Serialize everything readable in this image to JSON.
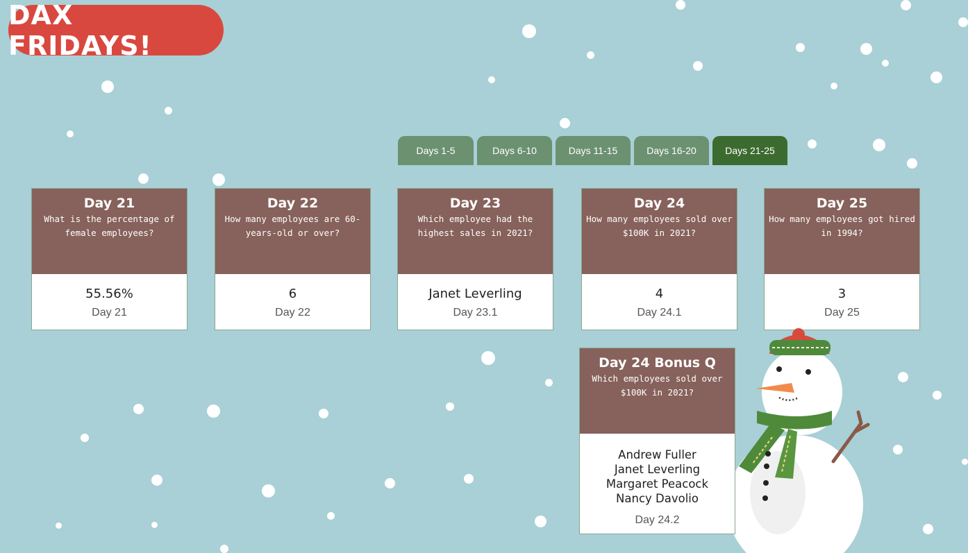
{
  "header": {
    "title": "DAX FRIDAYS!"
  },
  "tabs": [
    {
      "label": "Days 1-5",
      "active": false
    },
    {
      "label": "Days 6-10",
      "active": false
    },
    {
      "label": "Days 11-15",
      "active": false
    },
    {
      "label": "Days 16-20",
      "active": false
    },
    {
      "label": "Days 21-25",
      "active": true
    }
  ],
  "cards": [
    {
      "title": "Day 21",
      "question": "What is the percentage of female employees?",
      "value": "55.56%",
      "label": "Day 21"
    },
    {
      "title": "Day 22",
      "question": "How many employees are 60-years-old or over?",
      "value": "6",
      "label": "Day 22"
    },
    {
      "title": "Day 23",
      "question": "Which employee had the highest sales in 2021?",
      "value": "Janet Leverling",
      "label": "Day 23.1"
    },
    {
      "title": "Day 24",
      "question": "How many employees sold over $100K in 2021?",
      "value": "4",
      "label": "Day 24.1"
    },
    {
      "title": "Day 25",
      "question": "How many employees got hired in 1994?",
      "value": "3",
      "label": "Day 25"
    }
  ],
  "bonus": {
    "title": "Day 24 Bonus Q",
    "question": "Which employees sold over $100K in 2021?",
    "values": [
      "Andrew Fuller",
      "Janet Leverling",
      "Margaret Peacock",
      "Nancy Davolio"
    ],
    "label": "Day 24.2"
  },
  "colors": {
    "background": "#a8d0d6",
    "title_pill": "#d9483f",
    "tab": "#6b9171",
    "tab_active": "#3c6b2f",
    "card_header": "#87615b"
  },
  "icons": {
    "decoration": "snowman-icon",
    "snow": "snowflake-dots"
  }
}
